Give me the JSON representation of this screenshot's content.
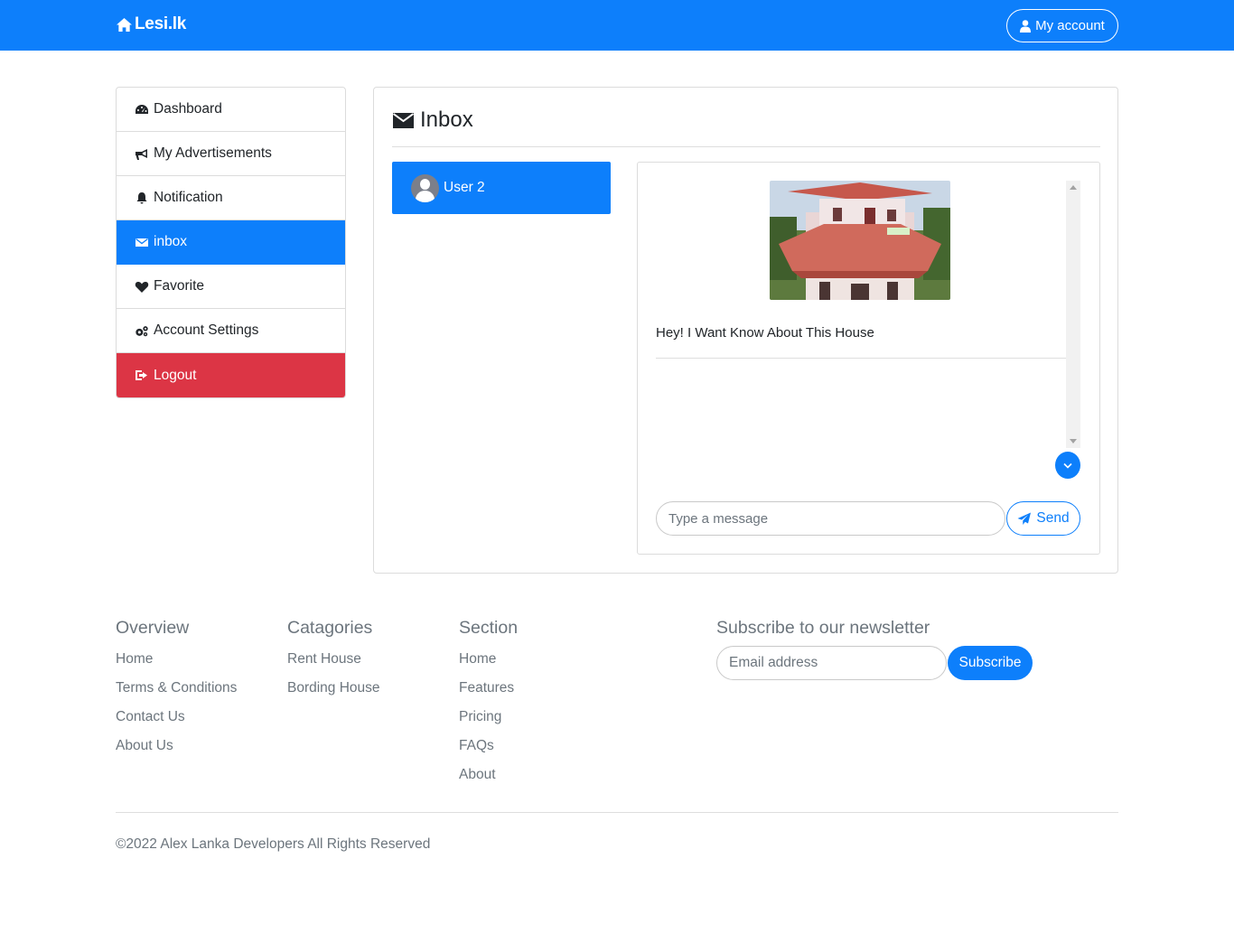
{
  "navbar": {
    "brand": "Lesi.lk",
    "account_label": "My account",
    "color": "#0d7ffb"
  },
  "sidebar": {
    "items": [
      {
        "label": "Dashboard",
        "icon": "dashboard-icon"
      },
      {
        "label": "My Advertisements",
        "icon": "bullhorn-icon"
      },
      {
        "label": "Notification",
        "icon": "bell-icon"
      },
      {
        "label": "inbox",
        "icon": "envelope-icon",
        "active": true
      },
      {
        "label": "Favorite",
        "icon": "heart-icon"
      },
      {
        "label": "Account Settings",
        "icon": "gears-icon"
      },
      {
        "label": "Logout",
        "icon": "sign-out-icon",
        "danger": true
      }
    ]
  },
  "inbox": {
    "title": "Inbox",
    "contacts": [
      {
        "name": "User 2",
        "selected": true
      }
    ],
    "messages": [
      {
        "image": "house-photo",
        "text": "Hey! I Want Know About This House"
      }
    ],
    "composer": {
      "placeholder": "Type a message",
      "send_label": "Send"
    }
  },
  "footer": {
    "columns": [
      {
        "title": "Overview",
        "links": [
          "Home",
          "Terms & Conditions",
          "Contact Us",
          "About Us"
        ]
      },
      {
        "title": "Catagories",
        "links": [
          "Rent House",
          "Bording House"
        ]
      },
      {
        "title": "Section",
        "links": [
          "Home",
          "Features",
          "Pricing",
          "FAQs",
          "About"
        ]
      }
    ],
    "newsletter": {
      "title": "Subscribe to our newsletter",
      "placeholder": "Email address",
      "button": "Subscribe"
    },
    "copyright": "©2022 Alex Lanka Developers All Rights Reserved"
  },
  "colors": {
    "primary": "#0d7ffb",
    "danger": "#dc3545",
    "muted": "#6c757d"
  }
}
